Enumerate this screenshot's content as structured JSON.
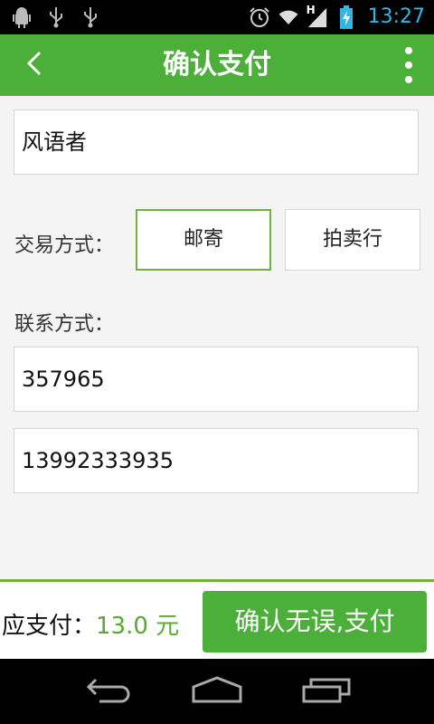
{
  "status_bar": {
    "time": "13:27",
    "left_icons": [
      "android-debug-icon",
      "usb-icon",
      "usb-icon"
    ],
    "right_icons": [
      "alarm-icon",
      "wifi-icon",
      "signal-icon",
      "battery-charging-icon"
    ],
    "signal_type": "H"
  },
  "app_bar": {
    "title": "确认支付",
    "back_icon": "chevron-left-icon",
    "menu_icon": "overflow-menu-icon"
  },
  "form": {
    "name_value": "风语者",
    "trade_label": "交易方式：",
    "trade_options": [
      "邮寄",
      "拍卖行"
    ],
    "trade_selected": "邮寄",
    "contact_label": "联系方式：",
    "contact_qq": "357965",
    "contact_phone": "13992333935"
  },
  "footer": {
    "pay_label": "应支付：",
    "amount": "13.0 元",
    "confirm_button": "确认无误,支付"
  },
  "colors": {
    "primary": "#4caf3a",
    "accent_border": "#6db33f",
    "amount_text": "#5aa832",
    "clock": "#33b5e5"
  }
}
